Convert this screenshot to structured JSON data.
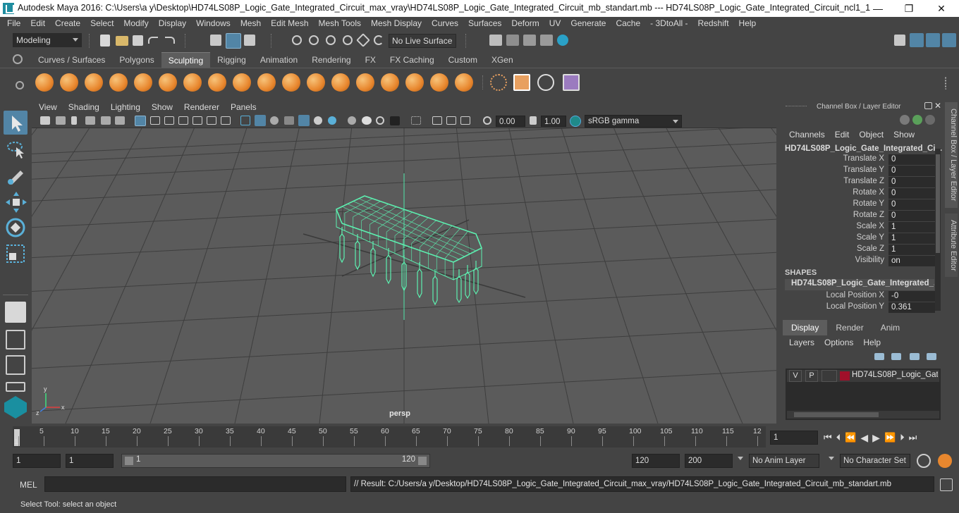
{
  "window": {
    "title": "Autodesk Maya 2016: C:\\Users\\a y\\Desktop\\HD74LS08P_Logic_Gate_Integrated_Circuit_max_vray\\HD74LS08P_Logic_Gate_Integrated_Circuit_mb_standart.mb   ---   HD74LS08P_Logic_Gate_Integrated_Circuit_ncl1_1",
    "minimize": "—",
    "maximize": "❐",
    "close": "✕"
  },
  "menubar": [
    "File",
    "Edit",
    "Create",
    "Select",
    "Modify",
    "Display",
    "Windows",
    "Mesh",
    "Edit Mesh",
    "Mesh Tools",
    "Mesh Display",
    "Curves",
    "Surfaces",
    "Deform",
    "UV",
    "Generate",
    "Cache",
    "- 3DtoAll -",
    "Redshift",
    "Help"
  ],
  "statusline": {
    "mode": "Modeling",
    "live_surface": "No Live Surface"
  },
  "shelf_tabs": [
    "Curves / Surfaces",
    "Polygons",
    "Sculpting",
    "Rigging",
    "Animation",
    "Rendering",
    "FX",
    "FX Caching",
    "Custom",
    "XGen"
  ],
  "active_shelf_tab": "Sculpting",
  "viewport": {
    "menu": [
      "View",
      "Shading",
      "Lighting",
      "Show",
      "Renderer",
      "Panels"
    ],
    "exposure": "0.00",
    "gamma": "1.00",
    "color_space": "sRGB gamma",
    "camera_label": "persp",
    "axis_labels": {
      "x": "x",
      "y": "y",
      "z": "z"
    }
  },
  "channel_box": {
    "header": "Channel Box / Layer Editor",
    "menu": [
      "Channels",
      "Edit",
      "Object",
      "Show"
    ],
    "object_name": "HD74LS08P_Logic_Gate_Integrated_Ci...",
    "attributes": [
      {
        "name": "Translate X",
        "value": "0"
      },
      {
        "name": "Translate Y",
        "value": "0"
      },
      {
        "name": "Translate Z",
        "value": "0"
      },
      {
        "name": "Rotate X",
        "value": "0"
      },
      {
        "name": "Rotate Y",
        "value": "0"
      },
      {
        "name": "Rotate Z",
        "value": "0"
      },
      {
        "name": "Scale X",
        "value": "1"
      },
      {
        "name": "Scale Y",
        "value": "1"
      },
      {
        "name": "Scale Z",
        "value": "1"
      },
      {
        "name": "Visibility",
        "value": "on"
      }
    ],
    "shapes_header": "SHAPES",
    "shape_name": "HD74LS08P_Logic_Gate_Integrated_...",
    "shape_attributes": [
      {
        "name": "Local Position X",
        "value": "-0"
      },
      {
        "name": "Local Position Y",
        "value": "0.361"
      }
    ]
  },
  "layer_editor": {
    "tabs": [
      "Display",
      "Render",
      "Anim"
    ],
    "active_tab": "Display",
    "menu": [
      "Layers",
      "Options",
      "Help"
    ],
    "layer": {
      "v": "V",
      "p": "P",
      "name": "HD74LS08P_Logic_Gate_I",
      "color": "#a0102a"
    }
  },
  "side_tabs": [
    "Channel Box / Layer Editor",
    "Attribute Editor"
  ],
  "timeline": {
    "ticks": [
      "1",
      "5",
      "10",
      "15",
      "20",
      "25",
      "30",
      "35",
      "40",
      "45",
      "50",
      "55",
      "60",
      "65",
      "70",
      "75",
      "80",
      "85",
      "90",
      "95",
      "100",
      "105",
      "110",
      "115",
      "12"
    ],
    "current_frame": "1"
  },
  "range": {
    "start": "1",
    "anim_start": "1",
    "slider_start": "1",
    "slider_end": "120",
    "end": "120",
    "anim_end": "200",
    "anim_layer": "No Anim Layer",
    "character_set": "No Character Set"
  },
  "command": {
    "label": "MEL",
    "result": "// Result: C:/Users/a y/Desktop/HD74LS08P_Logic_Gate_Integrated_Circuit_max_vray/HD74LS08P_Logic_Gate_Integrated_Circuit_mb_standart.mb"
  },
  "help_line": "Select Tool: select an object",
  "colors": {
    "wire": "#5cf0b0",
    "accent": "#5285a6",
    "orange": "#e8872e"
  }
}
